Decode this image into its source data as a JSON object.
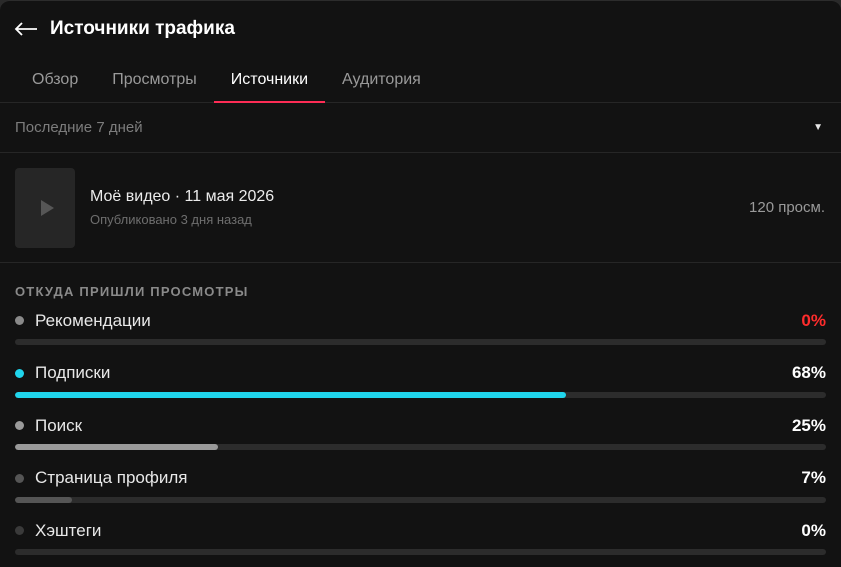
{
  "header": {
    "back_icon": "arrow-left-icon",
    "title": "Источники трафика"
  },
  "tabs": [
    {
      "label": "Обзор",
      "active": false
    },
    {
      "label": "Просмотры",
      "active": false
    },
    {
      "label": "Источники",
      "active": true
    },
    {
      "label": "Аудитория",
      "active": false
    }
  ],
  "filter": {
    "label": "Последние 7 дней",
    "caret_icon": "caret-down-icon",
    "caret_glyph": "▼"
  },
  "video": {
    "thumbnail_icon": "play-icon",
    "title": "Моё видео · 11 мая 2026",
    "subtitle": "Опубликовано 3 дня назад",
    "views": "120 просм."
  },
  "sources": {
    "section_title": "ОТКУДА ПРИШЛИ ПРОСМОТРЫ",
    "items": [
      {
        "label": "Рекомендации",
        "percent_text": "0%",
        "percent": 0,
        "bar_color": "#3a3a3a",
        "dot_color": "#8a8a8a",
        "percent_color": "#fe2c2c"
      },
      {
        "label": "Подписки",
        "percent_text": "68%",
        "percent": 68,
        "bar_color": "#20d5ec",
        "dot_color": "#20d5ec",
        "percent_color": "#ffffff"
      },
      {
        "label": "Поиск",
        "percent_text": "25%",
        "percent": 25,
        "bar_color": "#9a9a9a",
        "dot_color": "#9a9a9a",
        "percent_color": "#ffffff"
      },
      {
        "label": "Страница профиля",
        "percent_text": "7%",
        "percent": 7,
        "bar_color": "#555555",
        "dot_color": "#555555",
        "percent_color": "#ffffff"
      },
      {
        "label": "Хэштеги",
        "percent_text": "0%",
        "percent": 0,
        "bar_color": "#3a3a3a",
        "dot_color": "#3a3a3a",
        "percent_color": "#ffffff"
      }
    ]
  },
  "colors": {
    "accent": "#fe2c55",
    "background": "#121212"
  }
}
